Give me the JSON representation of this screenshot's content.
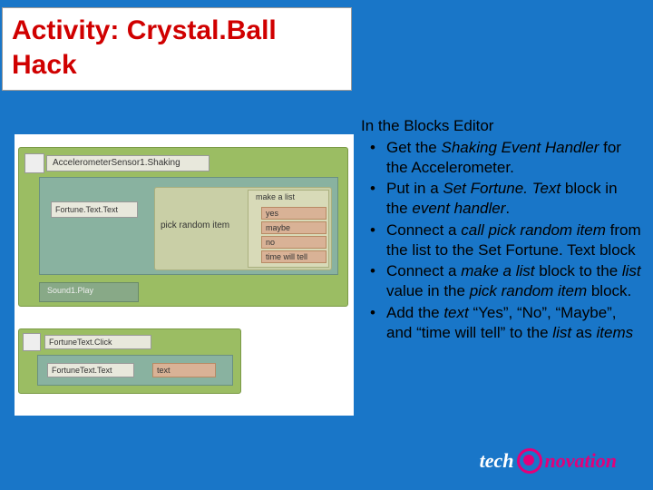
{
  "title": "Activity: Crystal.Ball Hack",
  "instructions": {
    "heading": "In the Blocks Editor",
    "items": [
      "Get the <i>Shaking Event Handler</i> for the Accelerometer.",
      "Put in a <i>Set Fortune. Text</i> block in the <i>event handler</i>.",
      "Connect a <i>call pick random item</i> from the list to the Set Fortune. Text block",
      "Connect a <i>make a list</i> block to the <i>list</i> value in the <i>pick random item</i> block.",
      "Add the <i>text</i> “Yes”, “No”, “Maybe”, and “time will tell” to the <i>list</i> as <i>items</i>"
    ]
  },
  "blocks": {
    "shaking_label": "AccelerometerSensor1.Shaking",
    "fortune_text_label": "Fortune.Text.Text",
    "pick_random_label": "pick random item",
    "make_list_label": "make a list",
    "list_items": [
      "yes",
      "maybe",
      "no",
      "time will tell"
    ],
    "sound_play": "Sound1.Play",
    "click_label": "FortuneText.Click",
    "click_set_label": "FortuneText.Text",
    "click_text_chip": "text"
  },
  "logo": {
    "part1": "tech",
    "part2": "novation"
  }
}
